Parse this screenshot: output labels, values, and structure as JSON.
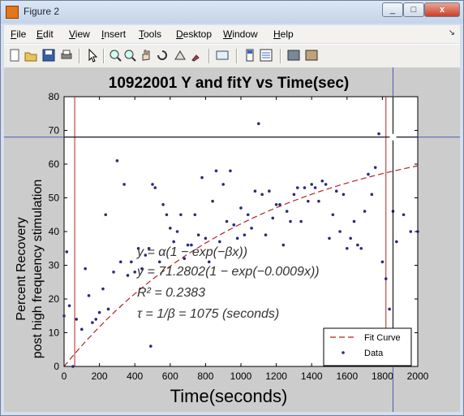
{
  "window": {
    "title": "Figure 2"
  },
  "title_buttons": {
    "minimize": "_",
    "maximize": "□",
    "close": "x"
  },
  "menu": [
    "File",
    "Edit",
    "View",
    "Insert",
    "Tools",
    "Desktop",
    "Window",
    "Help"
  ],
  "menu_access_keys": [
    "F",
    "E",
    "V",
    "I",
    "T",
    "D",
    "W",
    "H"
  ],
  "toolbar": [
    "new-figure-icon",
    "open-file-icon",
    "save-icon",
    "print-icon",
    "arrow-pointer-icon",
    "zoom-in-icon",
    "zoom-out-icon",
    "pan-hand-icon",
    "rotate-3d-icon",
    "data-cursor-icon",
    "brush-icon",
    "link-plot-icon",
    "colorbar-icon",
    "legend-icon",
    "hide-plot-tools-icon",
    "show-plot-tools-icon"
  ],
  "colors": {
    "fit": "#b22222",
    "data": "#2b2b7a",
    "cursor": "#4a5fa8",
    "plot_bg": "#ffffff",
    "figure_bg": "#cccccc"
  },
  "chart_data": {
    "type": "scatter",
    "title": "10922001 Y and fitY vs Time(sec)",
    "xlabel": "Time(seconds)",
    "ylabel_lines": [
      "Percent Recovery",
      "post high frequency stimulation"
    ],
    "xlim": [
      0,
      2000
    ],
    "ylim": [
      0,
      80
    ],
    "xticks": [
      0,
      200,
      400,
      600,
      800,
      1000,
      1200,
      1400,
      1600,
      1800,
      2000
    ],
    "yticks": [
      0,
      10,
      20,
      30,
      40,
      50,
      60,
      70,
      80
    ],
    "grid": false,
    "legend_position": "bottom-right",
    "legend": [
      {
        "name": "Fit Curve",
        "style": "dashed-line"
      },
      {
        "name": "Data",
        "style": "dot"
      }
    ],
    "series": [
      {
        "name": "Data",
        "points": [
          [
            0,
            15
          ],
          [
            15,
            34
          ],
          [
            30,
            18
          ],
          [
            50,
            0
          ],
          [
            70,
            14
          ],
          [
            100,
            11
          ],
          [
            120,
            29
          ],
          [
            140,
            21
          ],
          [
            160,
            13
          ],
          [
            180,
            14
          ],
          [
            200,
            16
          ],
          [
            220,
            23
          ],
          [
            235,
            45
          ],
          [
            250,
            17
          ],
          [
            280,
            28
          ],
          [
            300,
            61
          ],
          [
            320,
            31
          ],
          [
            340,
            54
          ],
          [
            360,
            27
          ],
          [
            380,
            31
          ],
          [
            400,
            28
          ],
          [
            420,
            35
          ],
          [
            440,
            29
          ],
          [
            460,
            33
          ],
          [
            480,
            35
          ],
          [
            490,
            6
          ],
          [
            500,
            54
          ],
          [
            515,
            53
          ],
          [
            540,
            31
          ],
          [
            560,
            48
          ],
          [
            580,
            45
          ],
          [
            600,
            41
          ],
          [
            620,
            37
          ],
          [
            640,
            40
          ],
          [
            660,
            45
          ],
          [
            680,
            32
          ],
          [
            700,
            36
          ],
          [
            720,
            36
          ],
          [
            740,
            45
          ],
          [
            760,
            39
          ],
          [
            780,
            56
          ],
          [
            800,
            38
          ],
          [
            820,
            31
          ],
          [
            840,
            49
          ],
          [
            860,
            58
          ],
          [
            880,
            37
          ],
          [
            900,
            54
          ],
          [
            920,
            43
          ],
          [
            940,
            58
          ],
          [
            960,
            42
          ],
          [
            980,
            38
          ],
          [
            1000,
            47
          ],
          [
            1020,
            39
          ],
          [
            1040,
            45
          ],
          [
            1060,
            41
          ],
          [
            1080,
            52
          ],
          [
            1100,
            72
          ],
          [
            1120,
            51
          ],
          [
            1140,
            39
          ],
          [
            1160,
            52
          ],
          [
            1180,
            44
          ],
          [
            1200,
            48
          ],
          [
            1220,
            48
          ],
          [
            1240,
            36
          ],
          [
            1260,
            46
          ],
          [
            1280,
            43
          ],
          [
            1300,
            51
          ],
          [
            1320,
            53
          ],
          [
            1340,
            43
          ],
          [
            1360,
            53
          ],
          [
            1380,
            49
          ],
          [
            1400,
            54
          ],
          [
            1420,
            53
          ],
          [
            1440,
            49
          ],
          [
            1460,
            55
          ],
          [
            1480,
            54
          ],
          [
            1500,
            38
          ],
          [
            1520,
            45
          ],
          [
            1540,
            52
          ],
          [
            1560,
            40
          ],
          [
            1580,
            51
          ],
          [
            1600,
            35
          ],
          [
            1620,
            38
          ],
          [
            1640,
            43
          ],
          [
            1660,
            36
          ],
          [
            1680,
            35
          ],
          [
            1700,
            46
          ],
          [
            1720,
            57
          ],
          [
            1740,
            51
          ],
          [
            1760,
            59
          ],
          [
            1780,
            69
          ],
          [
            1800,
            31
          ],
          [
            1820,
            26
          ],
          [
            1840,
            17
          ],
          [
            1860,
            46
          ],
          [
            1880,
            37
          ],
          [
            1920,
            45
          ],
          [
            1960,
            40
          ],
          [
            2000,
            40
          ]
        ]
      },
      {
        "name": "Fit Curve",
        "model": "y = a(1-exp(-b x))",
        "a": 71.2802,
        "b": 0.0009
      }
    ],
    "annotations": [
      "y = α(1 − exp(−βx))",
      "y = 71.2802(1 − exp(−0.0009x))",
      "R² = 0.2383",
      "τ = 1/β = 1075 (seconds)"
    ],
    "vertical_lines_x": [
      60,
      1820
    ],
    "cursor": {
      "x": 1860,
      "y": 68
    }
  }
}
